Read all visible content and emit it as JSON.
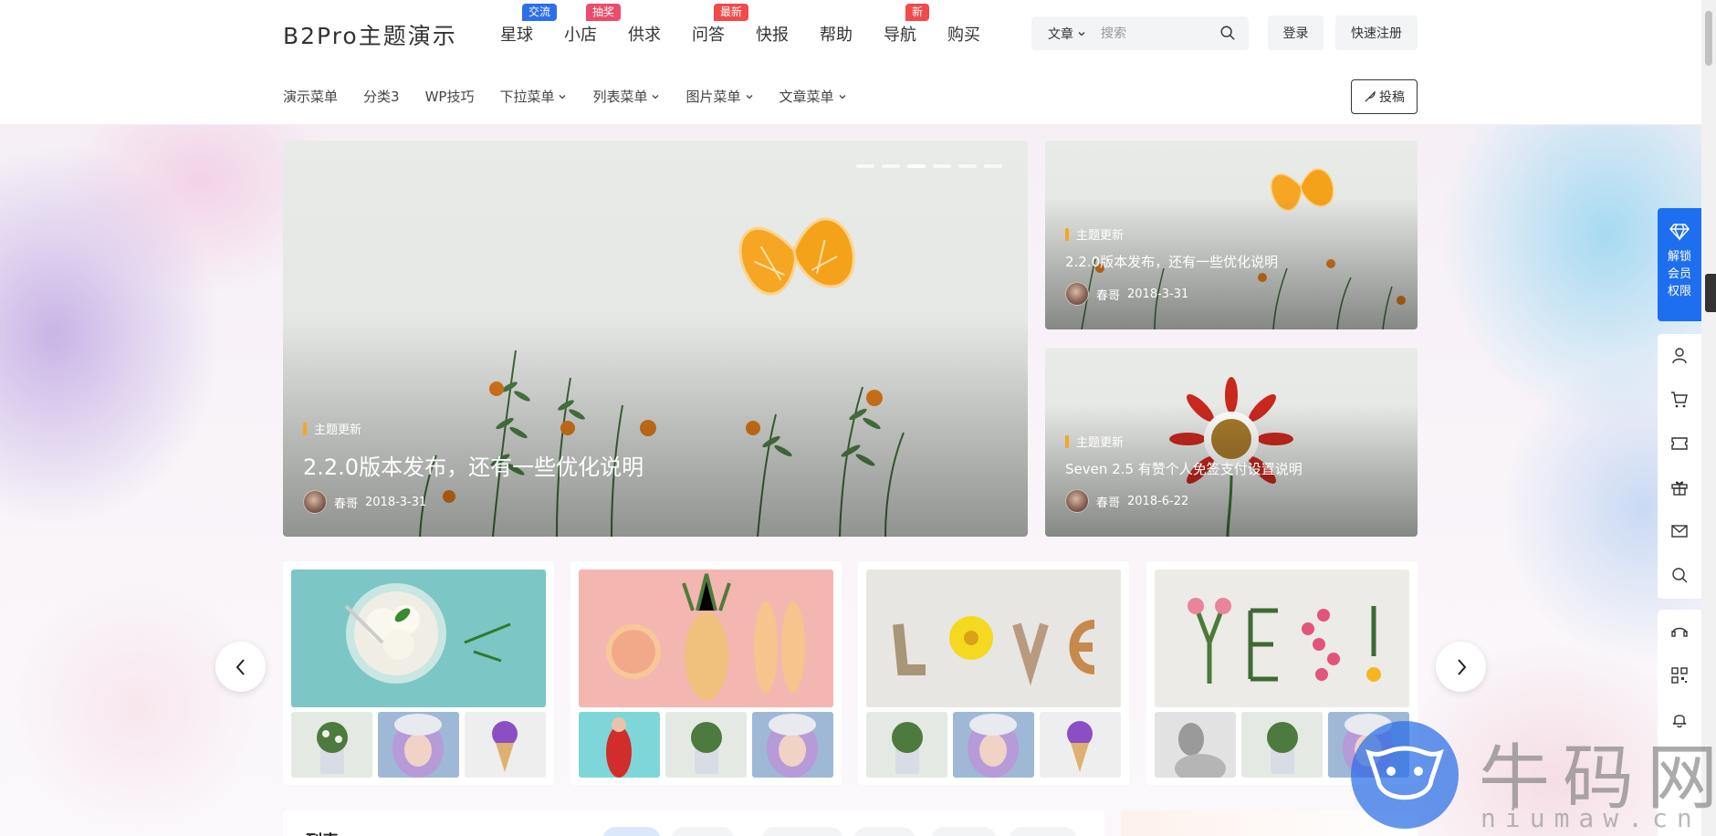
{
  "header": {
    "logo": "B2Pro主题演示",
    "nav": [
      {
        "label": "星球",
        "badge": "交流",
        "badge_color": "#2c6fe8"
      },
      {
        "label": "小店",
        "badge": "抽奖",
        "badge_color": "#ec4b6a"
      },
      {
        "label": "供求",
        "badge": "",
        "badge_color": ""
      },
      {
        "label": "问答",
        "badge": "最新",
        "badge_color": "#f04a4a"
      },
      {
        "label": "快报",
        "badge": "",
        "badge_color": ""
      },
      {
        "label": "帮助",
        "badge": "",
        "badge_color": ""
      },
      {
        "label": "导航",
        "badge": "新",
        "badge_color": "#f04a4a"
      },
      {
        "label": "购买",
        "badge": "",
        "badge_color": ""
      }
    ],
    "search": {
      "type": "文章",
      "placeholder": "搜索",
      "icon": "search-icon"
    },
    "login": "登录",
    "register": "快速注册"
  },
  "subnav": {
    "items": [
      {
        "label": "演示菜单",
        "dropdown": false
      },
      {
        "label": "分类3",
        "dropdown": false
      },
      {
        "label": "WP技巧",
        "dropdown": false
      },
      {
        "label": "下拉菜单",
        "dropdown": true
      },
      {
        "label": "列表菜单",
        "dropdown": true
      },
      {
        "label": "图片菜单",
        "dropdown": true
      },
      {
        "label": "文章菜单",
        "dropdown": true
      }
    ],
    "submit": "投稿"
  },
  "slider": {
    "active_index": 2,
    "slide_count": 6,
    "main": {
      "category": "主题更新",
      "title": "2.2.0版本发布，还有一些优化说明",
      "author": "春哥",
      "date": "2018-3-31"
    },
    "side": [
      {
        "category": "主题更新",
        "title": "2.2.0版本发布，还有一些优化说明",
        "author": "春哥",
        "date": "2018-3-31"
      },
      {
        "category": "主题更新",
        "title": "Seven 2.5 有赞个人免签支付设置说明",
        "author": "春哥",
        "date": "2018-6-22"
      }
    ]
  },
  "cards": [
    {
      "main_image": "ice-cream-bowl",
      "thumbs": [
        "flower-pot",
        "blue-hair-woman",
        "purple-ice-cream"
      ]
    },
    {
      "main_image": "fruit-shoes-pink",
      "thumbs": [
        "red-dress-woman",
        "flower-pot",
        "blue-hair-woman"
      ]
    },
    {
      "main_image": "love-letters",
      "thumbs": [
        "flower-pot",
        "blue-hair-woman",
        "purple-ice-cream"
      ]
    },
    {
      "main_image": "yes-flowers",
      "thumbs": [
        "bw-portrait",
        "flower-pot",
        "blue-hair-woman"
      ]
    }
  ],
  "list_section": {
    "title": "列表"
  },
  "floatbar": {
    "vip": "解锁会员权限",
    "tools": [
      "user-icon",
      "cart-icon",
      "ticket-icon",
      "gift-icon",
      "message-icon",
      "search-icon",
      "support-icon",
      "qrcode-icon",
      "bell-icon"
    ]
  },
  "watermark": {
    "main": "牛码网",
    "sub": "niumaw.cn"
  }
}
